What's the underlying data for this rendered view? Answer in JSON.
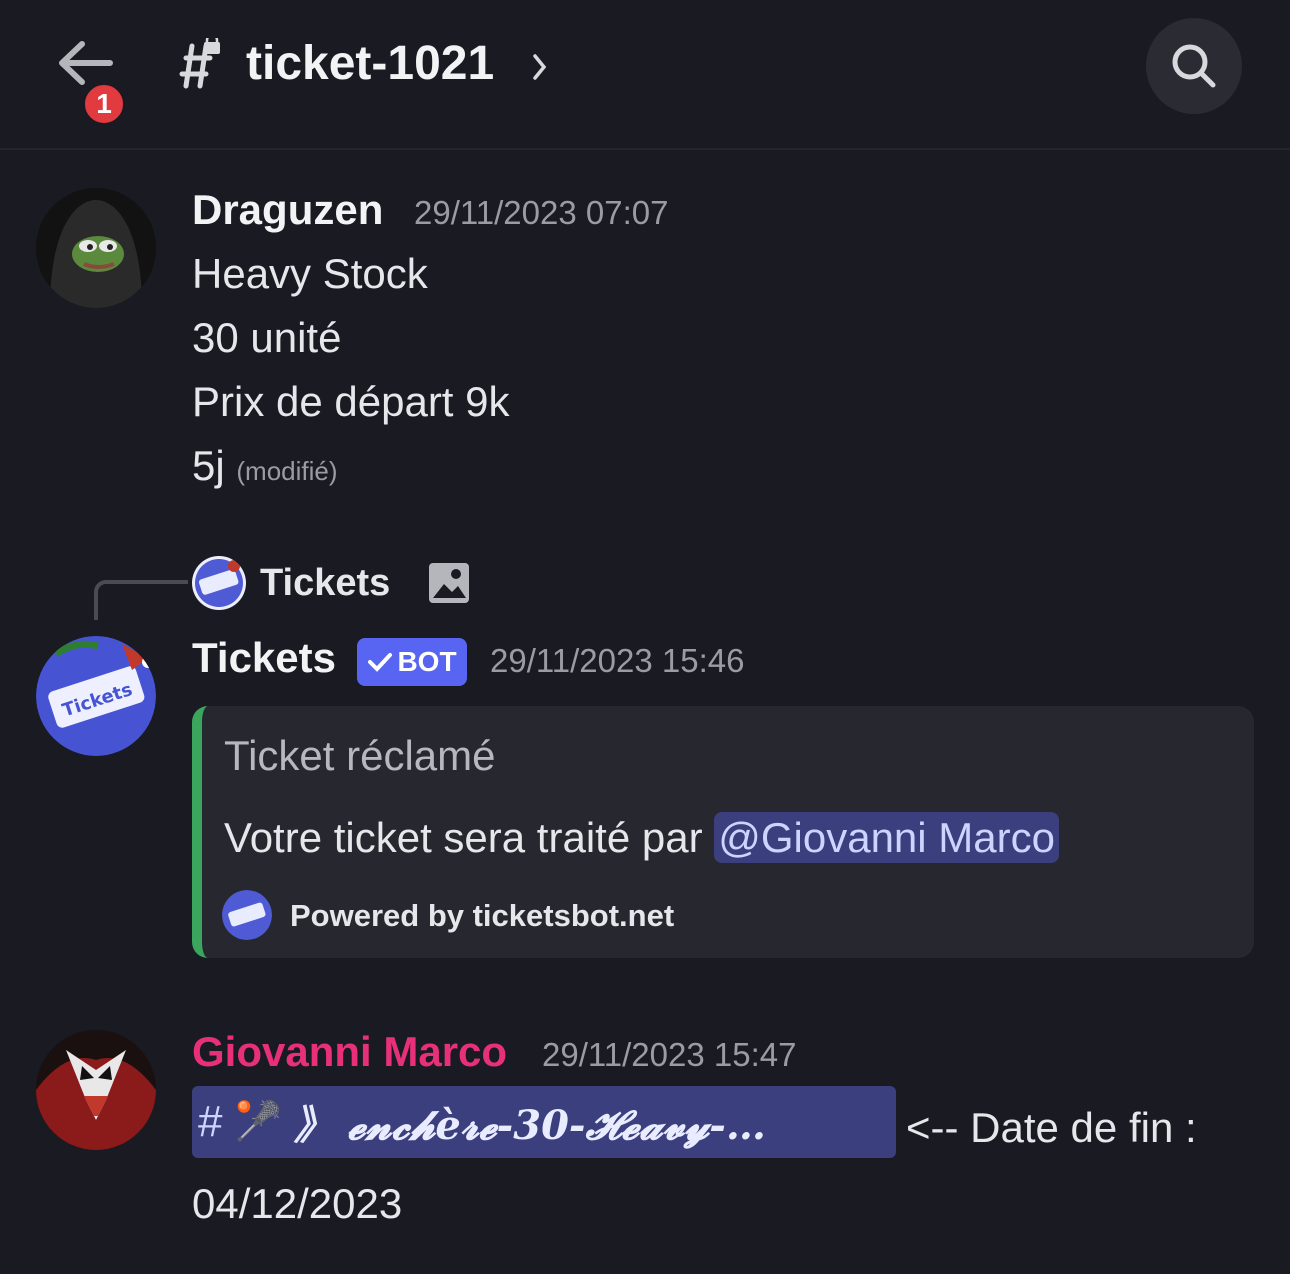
{
  "header": {
    "back_badge": "1",
    "channel_title": "ticket-1021"
  },
  "messages": [
    {
      "author": "Draguzen",
      "timestamp": "29/11/2023 07:07",
      "lines": [
        "Heavy Stock",
        "30 unité",
        "Prix de départ 9k",
        "5j"
      ],
      "edited_label": "(modifié)"
    },
    {
      "reply_to_name": "Tickets",
      "author": "Tickets",
      "bot_tag": "BOT",
      "timestamp": "29/11/2023 15:46",
      "embed": {
        "title": "Ticket réclamé",
        "description_prefix": "Votre ticket sera traité par ",
        "mention": "@Giovanni Marco",
        "footer": "Powered by ticketsbot.net",
        "accent_color": "#3ba55d"
      }
    },
    {
      "author": "Giovanni Marco",
      "author_color": "#e8307a",
      "timestamp": "29/11/2023 15:47",
      "channel_mention_hash": "#",
      "channel_mention_emoji": "🥍",
      "channel_mention_text": "》 𝓮𝓷𝓬𝓱è𝓻𝓮-30-𝓗𝓮𝓪𝓿𝔂-…",
      "after_mention": "<-- Date de fin :",
      "second_line": "04/12/2023"
    }
  ],
  "colors": {
    "background": "#1a1b22",
    "mention_bg": "#3b3f7d",
    "bot_tag": "#5865f2",
    "badge": "#e23b3f"
  }
}
